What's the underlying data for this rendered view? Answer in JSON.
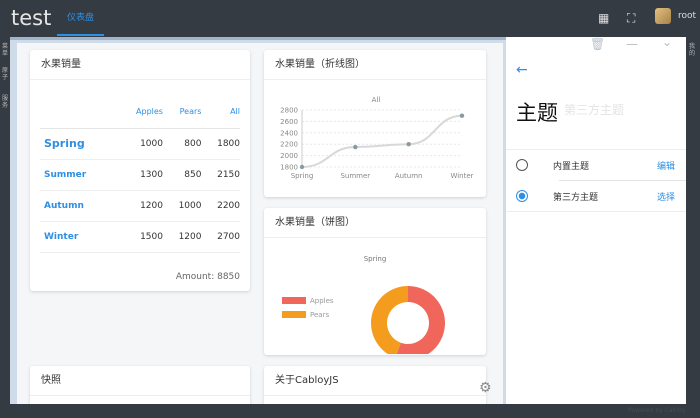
{
  "header": {
    "title": "test",
    "tab": "仪表盘",
    "user": "root"
  },
  "left_sidebar": [
    "菜单",
    "原子",
    "服务"
  ],
  "right_sidebar": "我的",
  "cards": {
    "sales": {
      "title": "水果销量",
      "columns": [
        "Apples",
        "Pears",
        "All"
      ],
      "rows": [
        {
          "season": "Spring",
          "apples": "1000",
          "pears": "800",
          "all": "1800"
        },
        {
          "season": "Summer",
          "apples": "1300",
          "pears": "850",
          "all": "2150"
        },
        {
          "season": "Autumn",
          "apples": "1200",
          "pears": "1000",
          "all": "2200"
        },
        {
          "season": "Winter",
          "apples": "1500",
          "pears": "1200",
          "all": "2700"
        }
      ],
      "amount": "Amount: 8850"
    },
    "line": {
      "title": "水果销量（折线图）"
    },
    "pie": {
      "title": "水果销量（饼图）"
    },
    "snapshot": {
      "title": "快照"
    },
    "about": {
      "title": "关于CabloyJS"
    }
  },
  "chart_data": [
    {
      "type": "line",
      "title": "All",
      "categories": [
        "Spring",
        "Summer",
        "Autumn",
        "Winter"
      ],
      "values": [
        1800,
        2150,
        2200,
        2700
      ],
      "yticks": [
        "1800",
        "2000",
        "2200",
        "2400",
        "2600",
        "2800"
      ],
      "ylim": [
        1800,
        2800
      ]
    },
    {
      "type": "pie",
      "title": "Spring",
      "legend": [
        "Apples",
        "Pears"
      ],
      "values": [
        1000,
        800
      ],
      "colors": [
        "#f0665a",
        "#f39c1e"
      ]
    }
  ],
  "panel": {
    "title": "主题",
    "faded_title": "第三方主题",
    "items": [
      {
        "label": "内置主题",
        "action": "编辑",
        "selected": false
      },
      {
        "label": "第三方主题",
        "action": "选择",
        "selected": true
      }
    ]
  },
  "footer": {
    "text": "Powered by Cabloy"
  }
}
